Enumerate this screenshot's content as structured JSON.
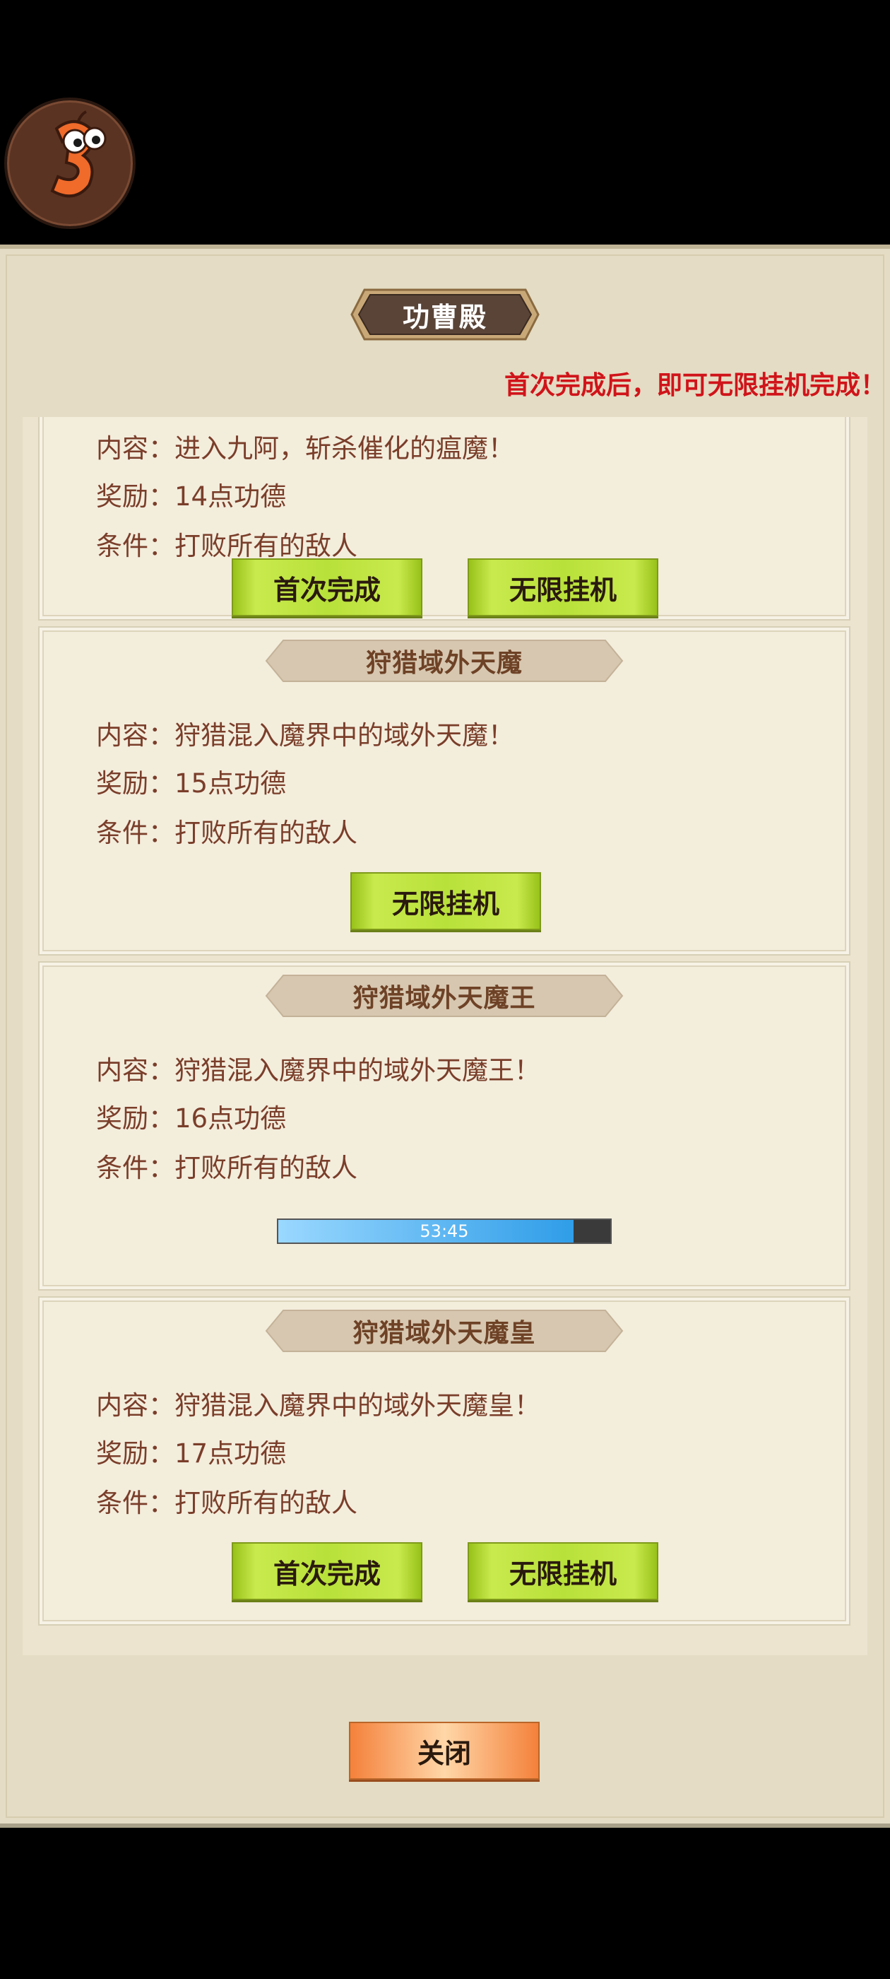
{
  "dialog": {
    "title": "功曹殿",
    "hint": "首次完成后，即可无限挂机完成！",
    "close_label": "关闭"
  },
  "tasks": [
    {
      "name": "",
      "content": "内容：进入九阿，斩杀催化的瘟魔！",
      "reward": "奖励：14点功德",
      "condition": "条件：打败所有的敌人",
      "first_label": "首次完成",
      "idle_label": "无限挂机"
    },
    {
      "name": "狩猎域外天魔",
      "content": "内容：狩猎混入魔界中的域外天魔！",
      "reward": "奖励：15点功德",
      "condition": "条件：打败所有的敌人",
      "idle_label": "无限挂机"
    },
    {
      "name": "狩猎域外天魔王",
      "content": "内容：狩猎混入魔界中的域外天魔王！",
      "reward": "奖励：16点功德",
      "condition": "条件：打败所有的敌人",
      "timer": "53:45",
      "progress": 0.89
    },
    {
      "name": "狩猎域外天魔皇",
      "content": "内容：狩猎混入魔界中的域外天魔皇！",
      "reward": "奖励：17点功德",
      "condition": "条件：打败所有的敌人",
      "first_label": "首次完成",
      "idle_label": "无限挂机"
    }
  ]
}
